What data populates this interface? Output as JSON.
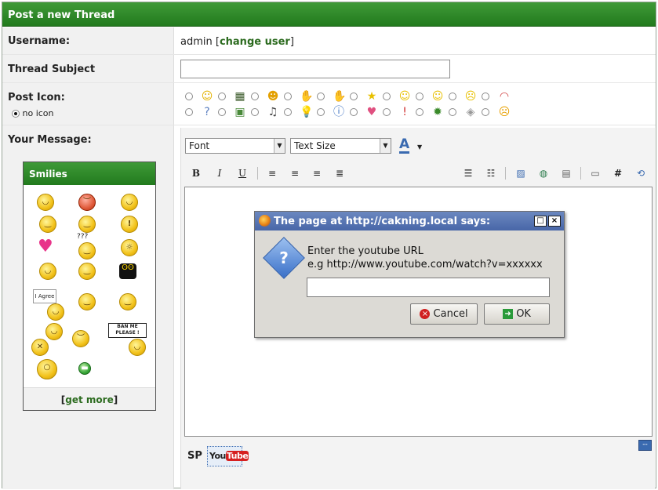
{
  "header": {
    "title": "Post a new Thread"
  },
  "form": {
    "username_label": "Username:",
    "username_value": "admin",
    "change_user_open": "[",
    "change_user_link": "change user",
    "change_user_close": "]",
    "subject_label": "Thread Subject",
    "post_icon_label": "Post Icon:",
    "no_icon_label": "no icon",
    "message_label": "Your Message:"
  },
  "smilies": {
    "title": "Smilies",
    "get_more_open": "[",
    "get_more_link": "get more",
    "get_more_close": "]",
    "sign_agree": "I Agree",
    "sign_ban": "BAN ME PLEASE !",
    "sign_question": "???"
  },
  "editor": {
    "font_select": "Font",
    "size_select": "Text Size",
    "bold": "B",
    "italic": "I",
    "underline": "U",
    "hash": "#",
    "sp_label": "SP",
    "youtube_you": "You",
    "youtube_tube": "Tube",
    "collapse": "--"
  },
  "dialog": {
    "title": "The page at http://cakning.local says:",
    "line1": "Enter the youtube URL",
    "line2": "e.g http://www.youtube.com/watch?v=xxxxxx",
    "input_value": "",
    "cancel": "Cancel",
    "ok": "OK",
    "maximize": "□",
    "close": "×"
  },
  "colors": {
    "accent_green": "#2f8a2a",
    "dialog_title_blue": "#5575b5"
  }
}
